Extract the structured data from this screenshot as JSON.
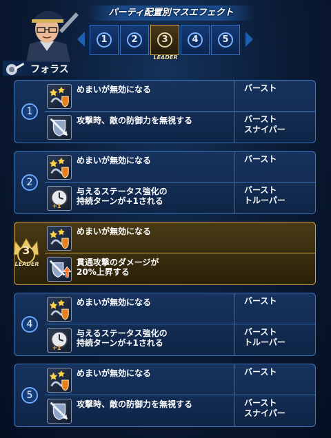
{
  "header": {
    "title": "パーティ配置別マスエフェクト",
    "slots": [
      "1",
      "2",
      "3",
      "4",
      "5"
    ],
    "active_slot": "3",
    "leader_label": "LEADER",
    "character_name": "フォラス"
  },
  "colors": {
    "normal_border": "#3f74b8",
    "leader_border": "#c9a64a"
  },
  "groups": [
    {
      "number": "1",
      "rows": [
        {
          "icon": "dizzy-immune-icon",
          "desc": "めまいが無効になる",
          "tags": "バースト"
        },
        {
          "icon": "armor-pierce-icon",
          "desc": "攻撃時、敵の防御力を無視する",
          "tags": "バースト\nスナイパー"
        }
      ]
    },
    {
      "number": "2",
      "rows": [
        {
          "icon": "dizzy-immune-icon",
          "desc": "めまいが無効になる",
          "tags": "バースト"
        },
        {
          "icon": "clock-plus-icon",
          "desc": "与えるステータス強化の\n持続ターンが+1される",
          "tags": "バースト\nトルーパー"
        }
      ]
    },
    {
      "number": "3",
      "leader": true,
      "leader_label": "LEADER",
      "rows": [
        {
          "icon": "dizzy-immune-icon",
          "desc": "めまいが無効になる",
          "tags": ""
        },
        {
          "icon": "pierce-damage-up-icon",
          "desc": "貫通攻撃のダメージが\n20%上昇する",
          "tags": ""
        }
      ]
    },
    {
      "number": "4",
      "rows": [
        {
          "icon": "dizzy-immune-icon",
          "desc": "めまいが無効になる",
          "tags": "バースト"
        },
        {
          "icon": "clock-plus-icon",
          "desc": "与えるステータス強化の\n持続ターンが+1される",
          "tags": "バースト\nトルーパー"
        }
      ]
    },
    {
      "number": "5",
      "rows": [
        {
          "icon": "dizzy-immune-icon",
          "desc": "めまいが無効になる",
          "tags": "バースト"
        },
        {
          "icon": "armor-pierce-icon",
          "desc": "攻撃時、敵の防御力を無視する",
          "tags": "バースト\nスナイパー"
        }
      ]
    }
  ]
}
